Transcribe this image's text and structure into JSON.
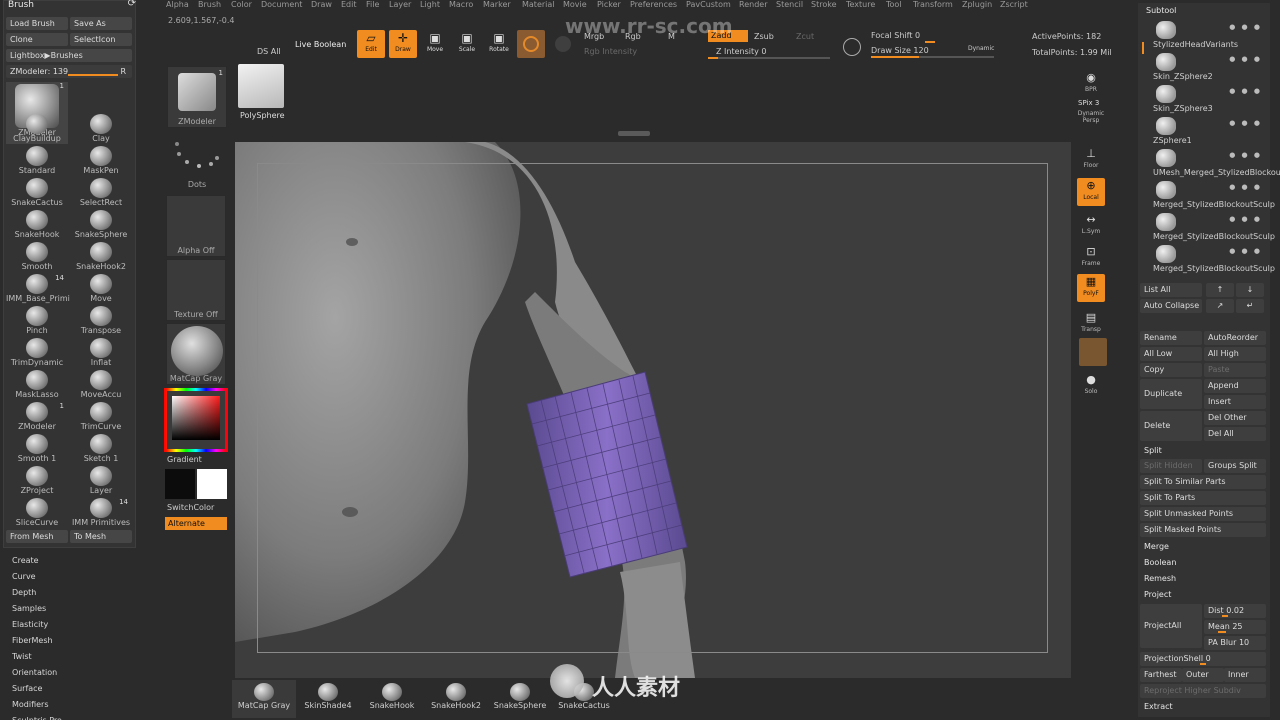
{
  "menu": {
    "items": [
      "Alpha",
      "Brush",
      "Color",
      "Document",
      "Draw",
      "Edit",
      "File",
      "Layer",
      "Light",
      "Macro",
      "Marker",
      "Material",
      "Movie",
      "Picker",
      "Preferences",
      "PavCustom",
      "Render",
      "Stencil",
      "Stroke",
      "Texture",
      "Tool",
      "Transform",
      "Zplugin",
      "Zscript"
    ],
    "coords": "2.609,1.567,-0.4"
  },
  "watermark": {
    "site": "www.rr-sc.com",
    "cn_text": "人人素材社区",
    "logo_text": "人人素材"
  },
  "brush_panel": {
    "title": "Brush",
    "buttons": {
      "load_brush": "Load Brush",
      "save_as": "Save As",
      "clone": "Clone",
      "select_icon": "SelectIcon",
      "lightbox": "Lightbox▶Brushes",
      "from_mesh": "From Mesh",
      "to_mesh": "To Mesh"
    },
    "slider": {
      "label": "ZModeler",
      "value": "139",
      "tag": "R"
    },
    "brushes": [
      {
        "label": "ZModeler",
        "count": "1"
      },
      {
        "label": "Clay",
        "count": ""
      },
      {
        "label": "ClayBuildup",
        "count": ""
      },
      {
        "label": "MaskPen",
        "count": ""
      },
      {
        "label": "Standard",
        "count": ""
      },
      {
        "label": "SelectRect",
        "count": ""
      },
      {
        "label": "SnakeCactus",
        "count": ""
      },
      {
        "label": "SnakeSphere",
        "count": ""
      },
      {
        "label": "SnakeHook",
        "count": ""
      },
      {
        "label": "SnakeHook2",
        "count": ""
      },
      {
        "label": "Smooth",
        "count": ""
      },
      {
        "label": "Move",
        "count": ""
      },
      {
        "label": "IMM_Base_Primi",
        "count": "14"
      },
      {
        "label": "Transpose",
        "count": ""
      },
      {
        "label": "Pinch",
        "count": ""
      },
      {
        "label": "Inflat",
        "count": ""
      },
      {
        "label": "TrimDynamic",
        "count": ""
      },
      {
        "label": "MoveAccu",
        "count": ""
      },
      {
        "label": "MaskLasso",
        "count": ""
      },
      {
        "label": "TrimCurve",
        "count": ""
      },
      {
        "label": "ZModeler",
        "count": "1"
      },
      {
        "label": "Sketch 1",
        "count": ""
      },
      {
        "label": "Smooth 1",
        "count": ""
      },
      {
        "label": "Layer",
        "count": ""
      },
      {
        "label": "ZProject",
        "count": ""
      },
      {
        "label": "IMM Primitives",
        "count": "14"
      },
      {
        "label": "SliceCurve",
        "count": ""
      }
    ],
    "sections": [
      "Create",
      "Curve",
      "Depth",
      "Samples",
      "Elasticity",
      "FiberMesh",
      "Twist",
      "Orientation",
      "Surface",
      "Modifiers",
      "Sculptris Pro"
    ]
  },
  "tool_column": {
    "tool_name": "ZModeler",
    "tool_count": "1",
    "poly_sphere": "PolySphere",
    "ds_all": "DS All",
    "dots": "Dots",
    "alpha": "Alpha Off",
    "texture": "Texture Off",
    "material": "MatCap Gray",
    "gradient": "Gradient",
    "switch_color": "SwitchColor",
    "alternate": "Alternate"
  },
  "toolbar": {
    "live_boolean": "Live Boolean",
    "edit": "Edit",
    "draw": "Draw",
    "move": "Move",
    "scale": "Scale",
    "rotate": "Rotate",
    "mrgb": "Mrgb",
    "rgb": "Rgb",
    "m": "M",
    "rgb_intensity": "Rgb Intensity",
    "zadd": "Zadd",
    "zsub": "Zsub",
    "zcut": "Zcut",
    "z_intensity": "Z Intensity 0",
    "focal_shift": "Focal Shift 0",
    "draw_size": "Draw Size 120",
    "dynamic": "Dynamic",
    "active_points": "ActivePoints: 182",
    "total_points": "TotalPoints: 1.99 Mil"
  },
  "shelf": {
    "bpr": "BPR",
    "spix": "SPix 3",
    "dynamic": "Dynamic",
    "persp": "Persp",
    "floor": "Floor",
    "local": "Local",
    "lsym": "L.Sym",
    "frame": "Frame",
    "polyf": "PolyF",
    "transp": "Transp",
    "solo": "Solo"
  },
  "subtool": {
    "title": "Subtool",
    "items": [
      "StylizedHeadVariants",
      "Skin_ZSphere2",
      "Skin_ZSphere3",
      "ZSphere1",
      "UMesh_Merged_StylizedBlockout",
      "Merged_StylizedBlockoutSculp",
      "Merged_StylizedBlockoutSculp",
      "Merged_StylizedBlockoutSculp"
    ],
    "list_all": "List All",
    "auto_collapse": "Auto Collapse",
    "rename": "Rename",
    "auto_reorder": "AutoReorder",
    "all_low": "All Low",
    "all_high": "All High",
    "copy": "Copy",
    "paste": "Paste",
    "duplicate": "Duplicate",
    "append": "Append",
    "insert": "Insert",
    "delete": "Delete",
    "del_other": "Del Other",
    "del_all": "Del All",
    "split": "Split",
    "split_hidden": "Split Hidden",
    "groups_split": "Groups Split",
    "split_similar": "Split To Similar Parts",
    "split_parts": "Split To Parts",
    "split_unmasked": "Split Unmasked Points",
    "split_masked": "Split Masked Points",
    "merge": "Merge",
    "boolean": "Boolean",
    "remesh": "Remesh",
    "project": "Project",
    "project_all": "ProjectAll",
    "dist": "Dist 0.02",
    "mean": "Mean 25",
    "pa_blur": "PA Blur 10",
    "projection_shell": "ProjectionShell 0",
    "farthest": "Farthest",
    "outer": "Outer",
    "inner": "Inner",
    "reproject": "Reproject Higher Subdiv",
    "extract": "Extract"
  },
  "bottom_brushes": [
    "MatCap Gray",
    "SkinShade4",
    "SnakeHook",
    "SnakeHook2",
    "SnakeSphere",
    "SnakeCactus"
  ],
  "colors": {
    "accent": "#f08c20",
    "panel": "#333333",
    "background": "#2b2b2b",
    "mesh_purple": "#7a62b8"
  }
}
